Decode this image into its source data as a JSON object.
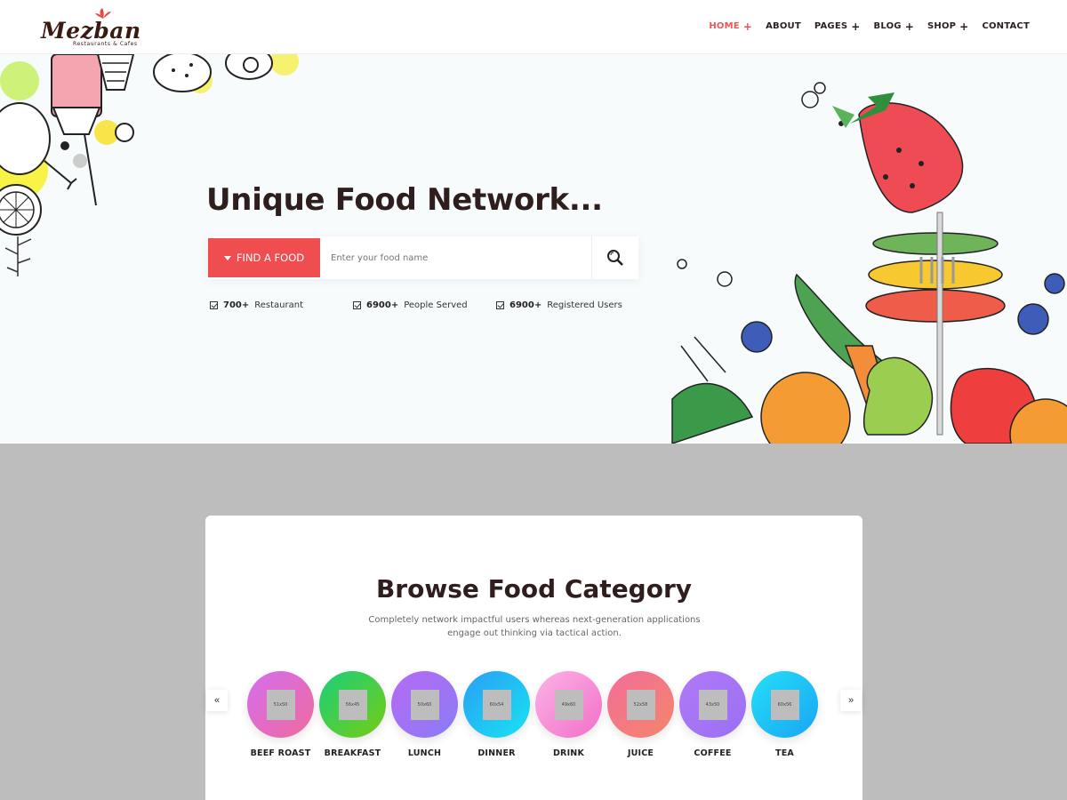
{
  "brand": {
    "name": "Mezban",
    "tagline": "Restaurants & Cafes",
    "accent": "#ef4d4f"
  },
  "nav": {
    "items": [
      {
        "label": "HOME",
        "has_submenu": true,
        "active": true
      },
      {
        "label": "ABOUT",
        "has_submenu": false,
        "active": false
      },
      {
        "label": "PAGES",
        "has_submenu": true,
        "active": false
      },
      {
        "label": "BLOG",
        "has_submenu": true,
        "active": false
      },
      {
        "label": "SHOP",
        "has_submenu": true,
        "active": false
      },
      {
        "label": "CONTACT",
        "has_submenu": false,
        "active": false
      }
    ]
  },
  "hero": {
    "title": "Unique Food Network...",
    "find_button": "FIND A FOOD",
    "search_placeholder": "Enter your food name",
    "stats": [
      {
        "value": "700+",
        "label": "Restaurant"
      },
      {
        "value": "6900+",
        "label": "People Served"
      },
      {
        "value": "6900+",
        "label": "Registered Users"
      }
    ]
  },
  "categories": {
    "title": "Browse Food Category",
    "description": "Completely network impactful users whereas next-generation applications engage out thinking via tactical action.",
    "prev_label": "«",
    "next_label": "»",
    "items": [
      {
        "label": "BEEF ROAST",
        "placeholder": "51x50",
        "gradient": [
          "#d36ef0",
          "#f06b9c"
        ]
      },
      {
        "label": "BREAKFAST",
        "placeholder": "56x45",
        "gradient": [
          "#19cf7d",
          "#76cc12"
        ]
      },
      {
        "label": "LUNCH",
        "placeholder": "50x60",
        "gradient": [
          "#b66bf5",
          "#8a7bf3"
        ]
      },
      {
        "label": "DINNER",
        "placeholder": "60x54",
        "gradient": [
          "#2a9df4",
          "#18e4f2"
        ]
      },
      {
        "label": "DRINK",
        "placeholder": "49x60",
        "gradient": [
          "#fbb3e6",
          "#f26fc8"
        ]
      },
      {
        "label": "JUICE",
        "placeholder": "52x58",
        "gradient": [
          "#f36d9a",
          "#f3866a"
        ]
      },
      {
        "label": "COFFEE",
        "placeholder": "43x50",
        "gradient": [
          "#b07bf7",
          "#9a6ff3"
        ]
      },
      {
        "label": "TEA",
        "placeholder": "60x56",
        "gradient": [
          "#24e0f6",
          "#1aa4f4"
        ]
      }
    ]
  }
}
